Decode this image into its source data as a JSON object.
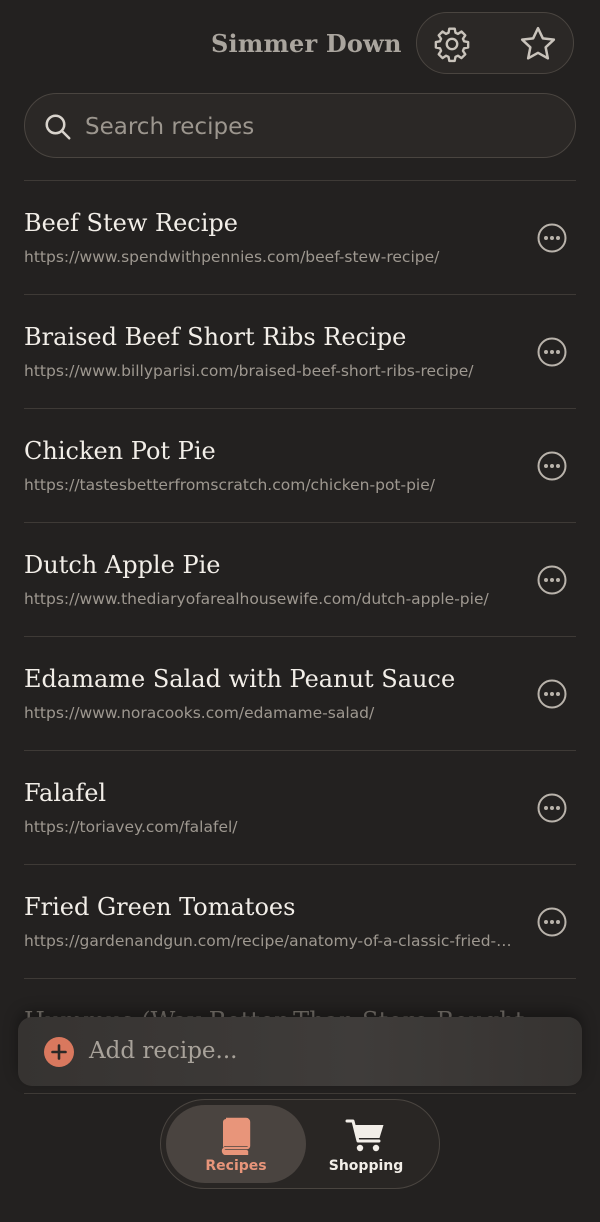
{
  "header": {
    "app_title": "Simmer Down",
    "settings_icon": "gear-icon",
    "favorites_icon": "star-icon"
  },
  "search": {
    "placeholder": "Search recipes",
    "value": ""
  },
  "recipes": [
    {
      "title": "Beef Stew Recipe",
      "url": "https://www.spendwithpennies.com/beef-stew-recipe/"
    },
    {
      "title": "Braised Beef Short Ribs Recipe",
      "url": "https://www.billyparisi.com/braised-beef-short-ribs-recipe/"
    },
    {
      "title": "Chicken Pot Pie",
      "url": "https://tastesbetterfromscratch.com/chicken-pot-pie/"
    },
    {
      "title": "Dutch Apple Pie",
      "url": "https://www.thediaryofarealhousewife.com/dutch-apple-pie/"
    },
    {
      "title": "Edamame Salad with Peanut Sauce",
      "url": "https://www.noracooks.com/edamame-salad/"
    },
    {
      "title": "Falafel",
      "url": "https://toriavey.com/falafel/"
    },
    {
      "title": "Fried Green Tomatoes",
      "url": "https://gardenandgun.com/recipe/anatomy-of-a-classic-fried-green-tomatoes/"
    },
    {
      "title": "Hummus (Way Better Than Store-Bought)",
      "url": ""
    }
  ],
  "add_recipe": {
    "label": "Add recipe...",
    "icon": "plus-circle-icon"
  },
  "tabs": [
    {
      "label": "Recipes",
      "icon": "book-icon",
      "active": true
    },
    {
      "label": "Shopping",
      "icon": "cart-icon",
      "active": false
    }
  ],
  "colors": {
    "background": "#232120",
    "accent": "#e8957a",
    "plus_button": "#d9785e"
  }
}
